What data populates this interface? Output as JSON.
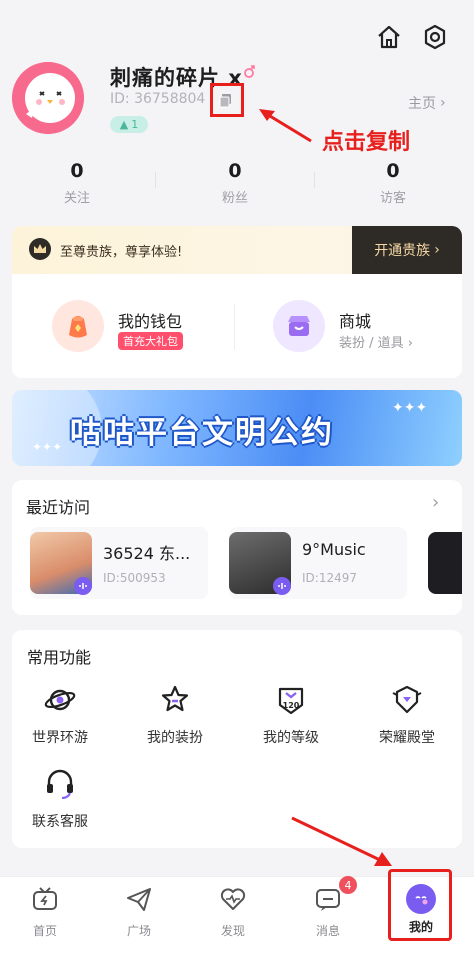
{
  "profile": {
    "nickname": "刺痛的碎片 x",
    "uid": "ID:  36758804",
    "level": "1",
    "home_link": "主页"
  },
  "annotations": {
    "copy_tip": "点击复制"
  },
  "stats": [
    {
      "value": "0",
      "label": "关注"
    },
    {
      "value": "0",
      "label": "粉丝"
    },
    {
      "value": "0",
      "label": "访客"
    }
  ],
  "noble": {
    "text": "至尊贵族，尊享体验!",
    "button": "开通贵族"
  },
  "wallet": {
    "title": "我的钱包",
    "tag": "首充大礼包"
  },
  "store": {
    "title": "商城",
    "subtitle": "装扮 / 道具"
  },
  "promo": {
    "text": "咕咕平台文明公约"
  },
  "recent": {
    "title": "最近访问",
    "items": [
      {
        "name": "36524 东...",
        "id": "ID:500953"
      },
      {
        "name": "9°Music",
        "id": "ID:12497"
      }
    ]
  },
  "functions": {
    "title": "常用功能",
    "items": [
      {
        "label": "世界环游",
        "icon": "planet-icon"
      },
      {
        "label": "我的装扮",
        "icon": "star-dress-icon"
      },
      {
        "label": "我的等级",
        "icon": "level-icon",
        "icon_text": "120"
      },
      {
        "label": "荣耀殿堂",
        "icon": "honor-icon"
      },
      {
        "label": "联系客服",
        "icon": "headset-icon"
      }
    ]
  },
  "nav": {
    "items": [
      {
        "label": "首页",
        "icon": "tv-icon"
      },
      {
        "label": "广场",
        "icon": "paper-plane-icon"
      },
      {
        "label": "发现",
        "icon": "heart-pulse-icon"
      },
      {
        "label": "消息",
        "icon": "message-icon",
        "badge": "4"
      },
      {
        "label": "我的",
        "icon": "me-avatar-icon"
      }
    ]
  },
  "colors": {
    "accent": "#7b5cf0",
    "annotation_red": "#e8201d",
    "avatar_pink": "#f86a8d"
  }
}
